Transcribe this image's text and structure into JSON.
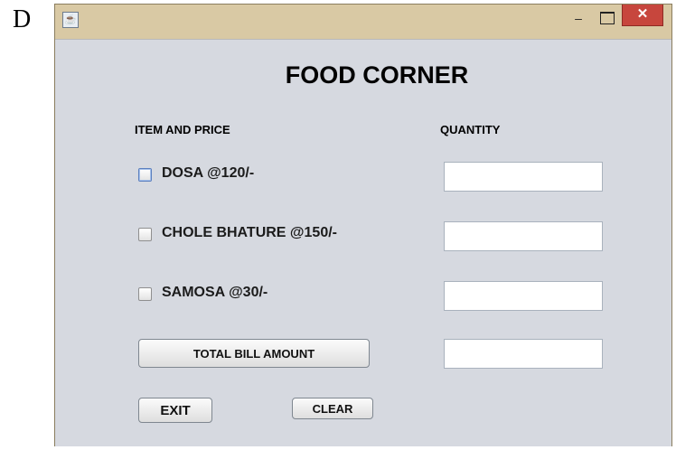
{
  "outer_label": "D",
  "window": {
    "title": "",
    "minimize_symbol": "–",
    "close_symbol": "✕",
    "app_icon": "java-coffee-cup-icon"
  },
  "form": {
    "title": "FOOD CORNER",
    "header_item": "ITEM AND PRICE",
    "header_quantity": "QUANTITY",
    "items": [
      {
        "label": "DOSA @120/-",
        "checked": false,
        "quantity": ""
      },
      {
        "label": "CHOLE BHATURE @150/-",
        "checked": false,
        "quantity": ""
      },
      {
        "label": "SAMOSA @30/-",
        "checked": false,
        "quantity": ""
      }
    ],
    "total_button": "TOTAL BILL AMOUNT",
    "total_value": "",
    "exit_button": "EXIT",
    "clear_button": "CLEAR"
  }
}
